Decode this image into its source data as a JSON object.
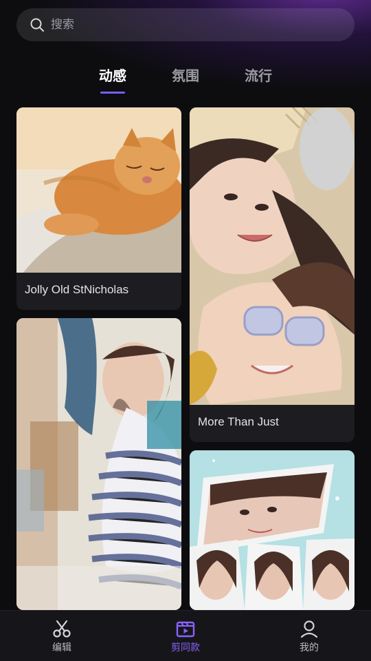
{
  "search": {
    "placeholder": "搜索"
  },
  "tabs": [
    {
      "label": "动感",
      "active": true
    },
    {
      "label": "氛围",
      "active": false
    },
    {
      "label": "流行",
      "active": false
    }
  ],
  "cards": [
    {
      "title": "Jolly Old StNicholas",
      "image": "sleeping-cat"
    },
    {
      "title": "More Than Just",
      "image": "two-girls-sunglasses"
    },
    {
      "title": "",
      "image": "blurry-girl-striped-shirt"
    },
    {
      "title": "",
      "image": "mirrored-portrait-collage"
    }
  ],
  "bottom_nav": [
    {
      "label": "编辑",
      "icon": "scissors-icon",
      "active": false
    },
    {
      "label": "剪同款",
      "icon": "clapperboard-icon",
      "active": true
    },
    {
      "label": "我的",
      "icon": "user-icon",
      "active": false
    }
  ],
  "colors": {
    "accent": "#7b5cff",
    "active_nav": "#8a63ff",
    "background": "#0d0d10"
  }
}
